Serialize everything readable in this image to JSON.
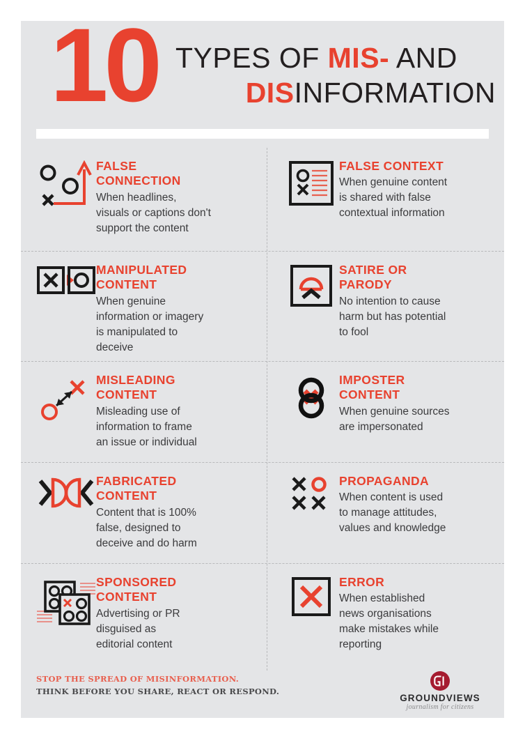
{
  "header": {
    "number": "10",
    "line1_pre": "TYPES OF ",
    "line1_accent": "MIS-",
    "line1_post": " AND",
    "line2_accent": "DIS",
    "line2_post": "INFORMATION"
  },
  "colors": {
    "accent_red": "#e8422f",
    "background": "#e4e5e7",
    "text_dark": "#231f20",
    "body_text": "#3b3b3d",
    "divider": "#b8b9bb",
    "bar_white": "#ffffff",
    "logo_red": "#a51c30"
  },
  "items": [
    {
      "icon": "circles-x-arrow-icon",
      "title": "FALSE\nCONNECTION",
      "desc": "When headlines,\nvisuals or captions don't\nsupport the content"
    },
    {
      "icon": "framed-circle-x-lines-icon",
      "title": "FALSE CONTEXT",
      "desc": "When genuine content\nis shared with false\ncontextual information"
    },
    {
      "icon": "boxed-x-arrow-boxed-circle-icon",
      "title": "MANIPULATED\nCONTENT",
      "desc": "When genuine\ninformation or imagery\nis manipulated to\ndeceive"
    },
    {
      "icon": "framed-arch-chevron-icon",
      "title": "SATIRE OR\nPARODY",
      "desc": "No intention to cause\nharm but has potential\nto fool"
    },
    {
      "icon": "circle-arrow-x-icon",
      "title": "MISLEADING\nCONTENT",
      "desc": "Misleading use of\ninformation to frame\nan issue or individual"
    },
    {
      "icon": "overlapping-circles-x-icon",
      "title": "IMPOSTER\nCONTENT",
      "desc": "When genuine sources\nare impersonated"
    },
    {
      "icon": "bowtie-chevrons-icon",
      "title": "FABRICATED\nCONTENT",
      "desc": "Content that is 100%\nfalse, designed to\ndeceive and do harm"
    },
    {
      "icon": "x-o-grid-icon",
      "title": "PROPAGANDA",
      "desc": "When content is used\nto manage attitudes,\nvalues and knowledge"
    },
    {
      "icon": "overlapping-squares-circles-icon",
      "title": "SPONSORED\nCONTENT",
      "desc": "Advertising or PR\ndisguised as\neditorial content"
    },
    {
      "icon": "boxed-red-x-icon",
      "title": "ERROR",
      "desc": "When established\nnews organisations\nmake mistakes while\nreporting"
    }
  ],
  "footer": {
    "line1": "STOP THE SPREAD OF MISINFORMATION.",
    "line2": "THINK BEFORE YOU SHARE, REACT OR RESPOND.",
    "logo_name": "GROUNDVIEWS",
    "logo_tagline": "journalism for citizens",
    "logo_monogram": "GV"
  }
}
